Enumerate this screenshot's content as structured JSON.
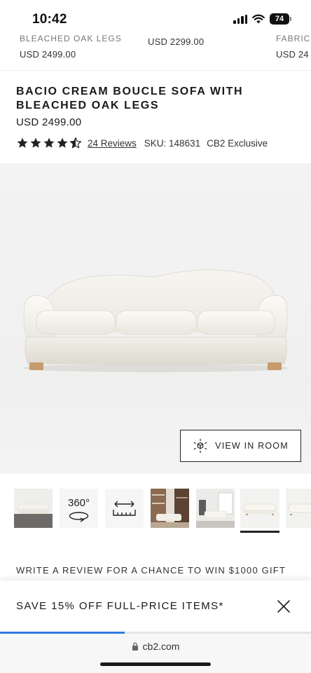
{
  "status_bar": {
    "time": "10:42",
    "battery": "74"
  },
  "top_strip": {
    "items": [
      {
        "name": "BLEACHED OAK LEGS",
        "price": "USD 2499.00"
      },
      {
        "name": "",
        "price": "USD 2299.00"
      },
      {
        "name": "FABRIC",
        "price": "USD 24"
      }
    ]
  },
  "product": {
    "title": "BACIO CREAM BOUCLE SOFA WITH BLEACHED OAK LEGS",
    "price": "USD 2499.00",
    "rating": 4.5,
    "reviews_label": "24 Reviews",
    "sku_label": "SKU: 148631",
    "exclusive_label": "CB2 Exclusive"
  },
  "hero": {
    "view_in_room_label": "VIEW IN ROOM",
    "icon": "ar-cube-icon"
  },
  "thumbnails": {
    "items": [
      {
        "kind": "sofa-grey-floor"
      },
      {
        "kind": "360",
        "label": "360°"
      },
      {
        "kind": "dimensions"
      },
      {
        "kind": "room-shelves"
      },
      {
        "kind": "room-window"
      },
      {
        "kind": "sofa-front",
        "active": true
      },
      {
        "kind": "sofa-side"
      }
    ]
  },
  "promo": {
    "review_text": "WRITE A REVIEW FOR A CHANCE TO WIN $1000 GIFT",
    "banner_text": "SAVE 15% OFF FULL-PRICE ITEMS*"
  },
  "browser": {
    "url": "cb2.com",
    "load_progress": 0.4
  },
  "colors": {
    "accent_blue": "#2f7de1",
    "text_dark": "#1a1a1a"
  }
}
